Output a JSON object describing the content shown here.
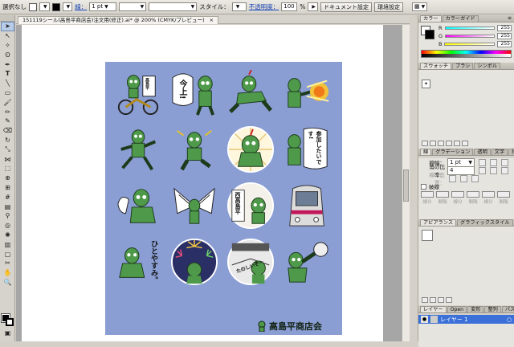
{
  "control_bar": {
    "selection": "選択なし",
    "stroke_label": "線：",
    "stroke_weight": "1 pt",
    "style_label": "スタイル：",
    "opacity_label": "不透明度：",
    "opacity_value": "100",
    "opacity_unit": "%",
    "doc_setup": "ドキュメント設定",
    "prefs": "環境設定"
  },
  "document": {
    "tab_title": "151119シール(高島平商店会)注文用(修正).ai* @ 200% (CMYK/プレビュー)",
    "close": "×"
  },
  "artwork": {
    "sticker_texts": [
      "高島平",
      "今上!",
      "参加したいです!",
      "西高島平",
      "ひとやすみ。",
      "たのしいぞー"
    ],
    "logo_text": "高島平商店会"
  },
  "color_panel": {
    "tabs": [
      "カラー",
      "カラーガイド"
    ],
    "channels": [
      {
        "label": "R",
        "value": "255"
      },
      {
        "label": "G",
        "value": "255"
      },
      {
        "label": "B",
        "value": "255"
      }
    ]
  },
  "swatch_panel": {
    "tabs": [
      "スウォッチ",
      "ブラシ",
      "シンボル"
    ]
  },
  "stroke_panel": {
    "tabs": [
      "線",
      "グラデーション",
      "透明",
      "文字",
      "段落"
    ],
    "weight_label": "線幅：",
    "weight_value": "1 pt",
    "miter_label": "角の比率：",
    "miter_value": "4",
    "align_label": "線の位置：",
    "dashed_label": "破線",
    "dash_labels": [
      "線分",
      "間隔",
      "線分",
      "間隔",
      "線分",
      "間隔"
    ]
  },
  "appearance_panel": {
    "tabs": [
      "アピアランス",
      "グラフィックスタイル"
    ]
  },
  "layers_panel": {
    "tabs": [
      "レイヤー",
      "Open",
      "変形",
      "整列",
      "パス"
    ],
    "layer_name": "レイヤー 1"
  },
  "colors": {
    "art_background": "#8a9ed3",
    "layer_highlight": "#3a70d8",
    "hero_green": "#4f9a4a"
  }
}
